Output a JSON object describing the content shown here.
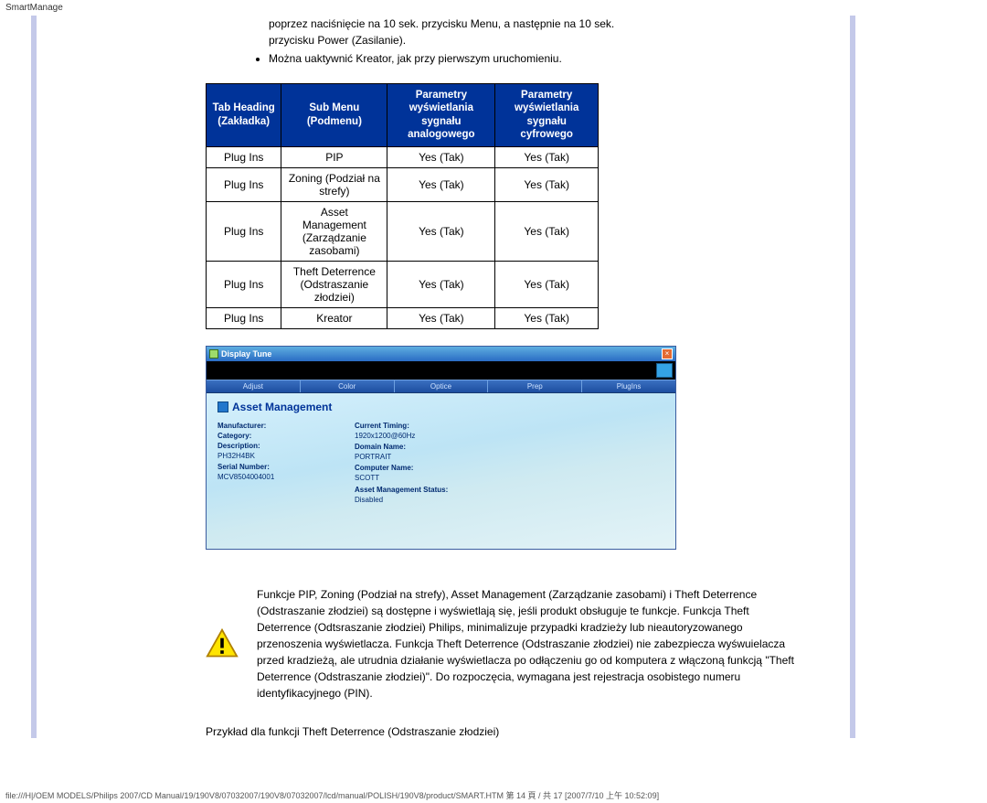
{
  "top_label": "SmartManage",
  "intro": {
    "line1": "poprzez naciśnięcie na 10 sek. przycisku Menu, a następnie na 10 sek. przycisku Power (Zasilanie).",
    "line2": "Można uaktywnić Kreator, jak przy pierwszym uruchomieniu."
  },
  "table": {
    "headers": [
      "Tab Heading (Zakładka)",
      "Sub Menu (Podmenu)",
      "Parametry wyświetlania sygnału analogowego",
      "Parametry wyświetlania sygnału cyfrowego"
    ],
    "rows": [
      [
        "Plug Ins",
        "PIP",
        "Yes (Tak)",
        "Yes (Tak)"
      ],
      [
        "Plug Ins",
        "Zoning (Podział na strefy)",
        "Yes (Tak)",
        "Yes (Tak)"
      ],
      [
        "Plug Ins",
        "Asset Management (Zarządzanie zasobami)",
        "Yes (Tak)",
        "Yes (Tak)"
      ],
      [
        "Plug Ins",
        "Theft Deterrence (Odstraszanie złodziei)",
        "Yes (Tak)",
        "Yes (Tak)"
      ],
      [
        "Plug Ins",
        "Kreator",
        "Yes (Tak)",
        "Yes (Tak)"
      ]
    ]
  },
  "screenshot": {
    "window_title": "Display Tune",
    "menu": [
      "Adjust",
      "Color",
      "Optice",
      "Prep",
      "PlugIns"
    ],
    "heading": "Asset Management",
    "col1": {
      "manufacturer_lbl": "Manufacturer:",
      "category_lbl": "Category:",
      "description_lbl": "Description:",
      "description_val": "PH32H4BK",
      "serial_lbl": "Serial Number:",
      "serial_val": "MCV8504004001"
    },
    "col2": {
      "timing_lbl": "Current Timing:",
      "timing_val": "1920x1200@60Hz",
      "domain_lbl": "Domain Name:",
      "domain_val": "PORTRAIT",
      "computer_lbl": "Computer Name:",
      "computer_val": "SCOTT",
      "status_lbl": "Asset Management Status:",
      "status_val": "Disabled"
    }
  },
  "warning_text": "Funkcje PIP, Zoning (Podział na strefy), Asset Management (Zarządzanie zasobami) i Theft Deterrence (Odstraszanie złodziei) są dostępne i wyświetlają się, jeśli produkt obsługuje te funkcje. Funkcja Theft Deterrence (Odtsraszanie złodziei) Philips, minimalizuje przypadki kradzieży lub nieautoryzowanego przenoszenia wyświetlacza. Funkcja Theft Deterrence (Odstraszanie złodziei) nie zabezpiecza wyśwuielacza przed kradzieżą, ale utrudnia działanie wyświetlacza po odłączeniu go od komputera z włączoną funkcją \"Theft Deterrence (Odstraszanie złodziei)\". Do rozpoczęcia, wymagana jest rejestracja osobistego numeru identyfikacyjnego (PIN).",
  "example_line": "Przykład dla funkcji Theft Deterrence (Odstraszanie złodziei)",
  "footer": "file:///H|/OEM MODELS/Philips 2007/CD Manual/19/190V8/07032007/190V8/07032007/lcd/manual/POLISH/190V8/product/SMART.HTM 第 14 頁 / 共 17  [2007/7/10 上午 10:52:09]"
}
